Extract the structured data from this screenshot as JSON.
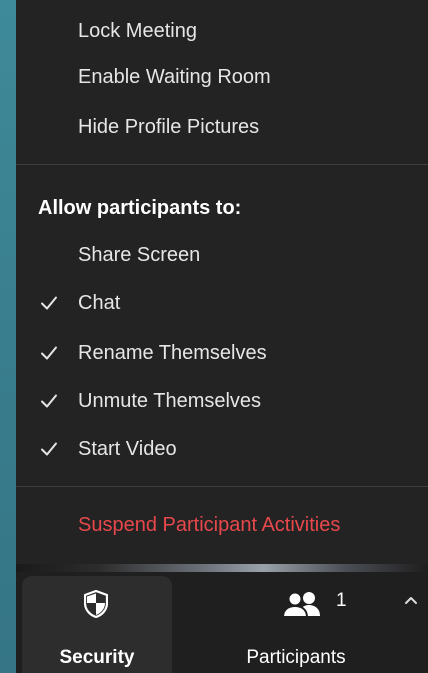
{
  "menu": {
    "top_items": [
      {
        "label": "Lock Meeting"
      },
      {
        "label": "Enable Waiting Room"
      },
      {
        "label": "Hide Profile Pictures"
      }
    ],
    "section_heading": "Allow participants to:",
    "allow_items": [
      {
        "label": "Share Screen",
        "checked": false
      },
      {
        "label": "Chat",
        "checked": true
      },
      {
        "label": "Rename Themselves",
        "checked": true
      },
      {
        "label": "Unmute Themselves",
        "checked": true
      },
      {
        "label": "Start Video",
        "checked": true
      }
    ],
    "danger_item": {
      "label": "Suspend Participant Activities",
      "color": "#e8484b"
    }
  },
  "toolbar": {
    "security": {
      "label": "Security",
      "icon": "shield-icon"
    },
    "participants": {
      "label": "Participants",
      "count": "1",
      "icon": "participants-icon"
    },
    "caret_icon": "chevron-up-icon"
  }
}
